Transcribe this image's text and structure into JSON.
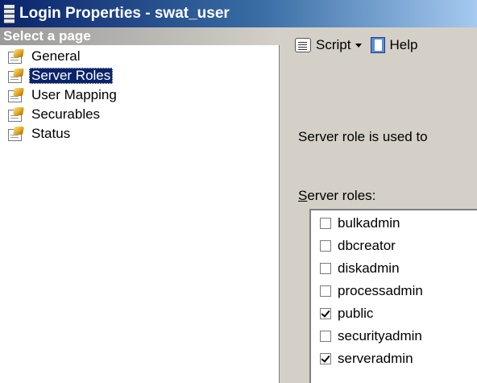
{
  "window": {
    "title": "Login Properties - swat_user"
  },
  "sidebar": {
    "header": "Select a page",
    "items": [
      {
        "label": "General",
        "selected": false
      },
      {
        "label": "Server Roles",
        "selected": true
      },
      {
        "label": "User Mapping",
        "selected": false
      },
      {
        "label": "Securables",
        "selected": false
      },
      {
        "label": "Status",
        "selected": false
      }
    ]
  },
  "toolbar": {
    "script_label": "Script",
    "help_label": "Help"
  },
  "main": {
    "description": "Server role is used to",
    "roles_label_accel": "S",
    "roles_label_rest": "erver roles:",
    "roles": [
      {
        "name": "bulkadmin",
        "checked": false
      },
      {
        "name": "dbcreator",
        "checked": false
      },
      {
        "name": "diskadmin",
        "checked": false
      },
      {
        "name": "processadmin",
        "checked": false
      },
      {
        "name": "public",
        "checked": true
      },
      {
        "name": "securityadmin",
        "checked": false
      },
      {
        "name": "serveradmin",
        "checked": true
      }
    ]
  },
  "colors": {
    "title_bar": "#0a246a",
    "selection": "#0a246a",
    "dialog_bg": "#d4d0c8"
  }
}
